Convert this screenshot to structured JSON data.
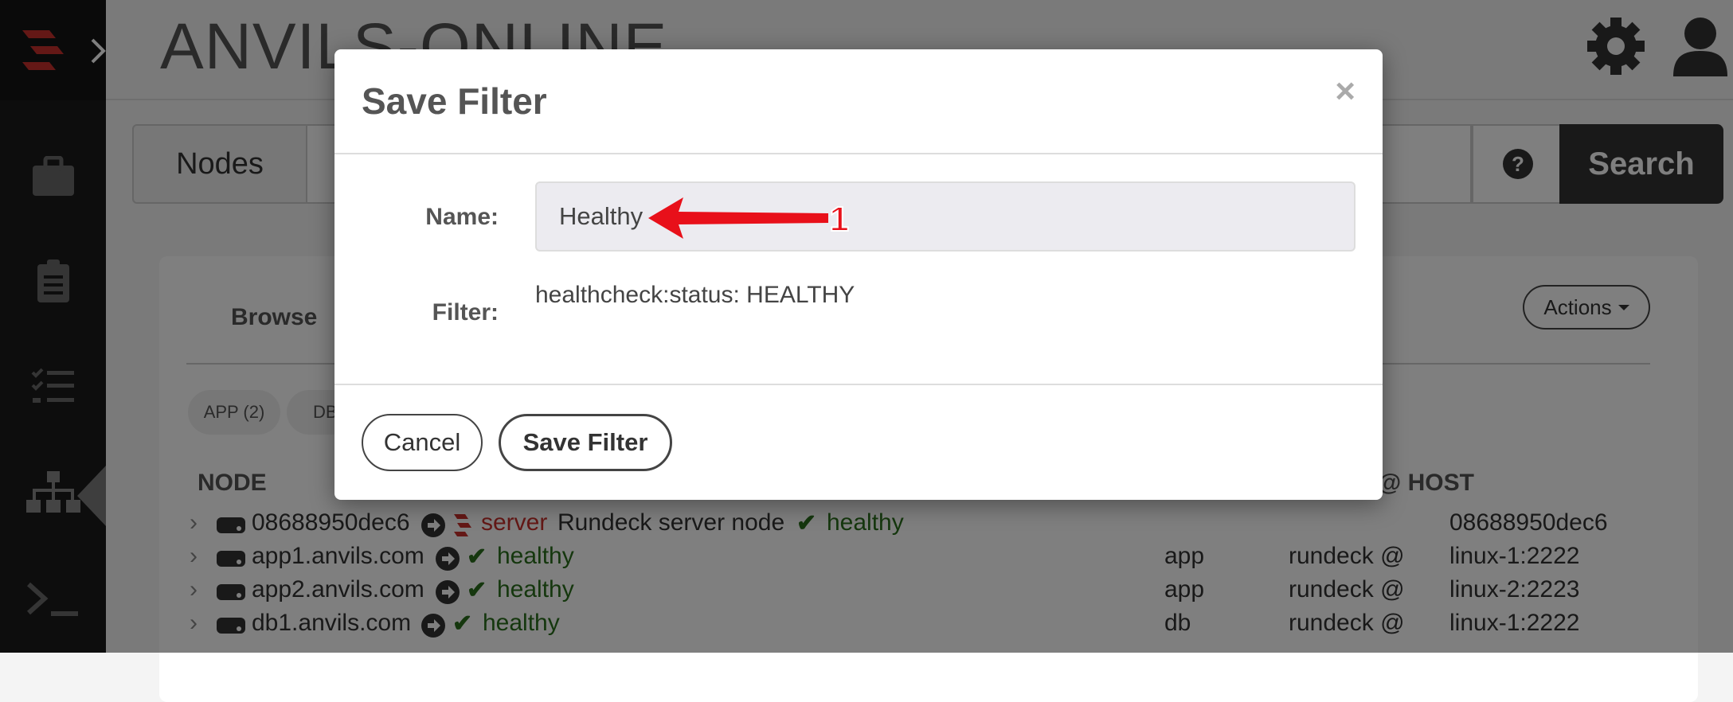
{
  "app": {
    "title": "ANVILS-ONLINE"
  },
  "search": {
    "nodes_tab": "Nodes",
    "help_label": "?",
    "search_button": "Search"
  },
  "content": {
    "browse_tab": "Browse",
    "actions_button": "Actions",
    "tags": [
      "APP (2)",
      "DB ("
    ],
    "columns": {
      "node": "NODE",
      "host": "@ HOST"
    },
    "rows": [
      {
        "name": "08688950dec6",
        "badge": "server",
        "desc": "Rundeck server node",
        "status": "healthy",
        "tags": "",
        "user": "",
        "host": "08688950dec6"
      },
      {
        "name": "app1.anvils.com",
        "badge": "",
        "desc": "",
        "status": "healthy",
        "tags": "app",
        "user": "rundeck @",
        "host": "linux-1:2222"
      },
      {
        "name": "app2.anvils.com",
        "badge": "",
        "desc": "",
        "status": "healthy",
        "tags": "app",
        "user": "rundeck @",
        "host": "linux-2:2223"
      },
      {
        "name": "db1.anvils.com",
        "badge": "",
        "desc": "",
        "status": "healthy",
        "tags": "db",
        "user": "rundeck @",
        "host": "linux-1:2222"
      }
    ]
  },
  "modal": {
    "title": "Save Filter",
    "close": "×",
    "name_label": "Name:",
    "name_value": "Healthy",
    "filter_label": "Filter:",
    "filter_value": "healthcheck:status: HEALTHY",
    "cancel": "Cancel",
    "save": "Save Filter"
  },
  "annotation": {
    "number": "1",
    "color": "#e8101a"
  }
}
